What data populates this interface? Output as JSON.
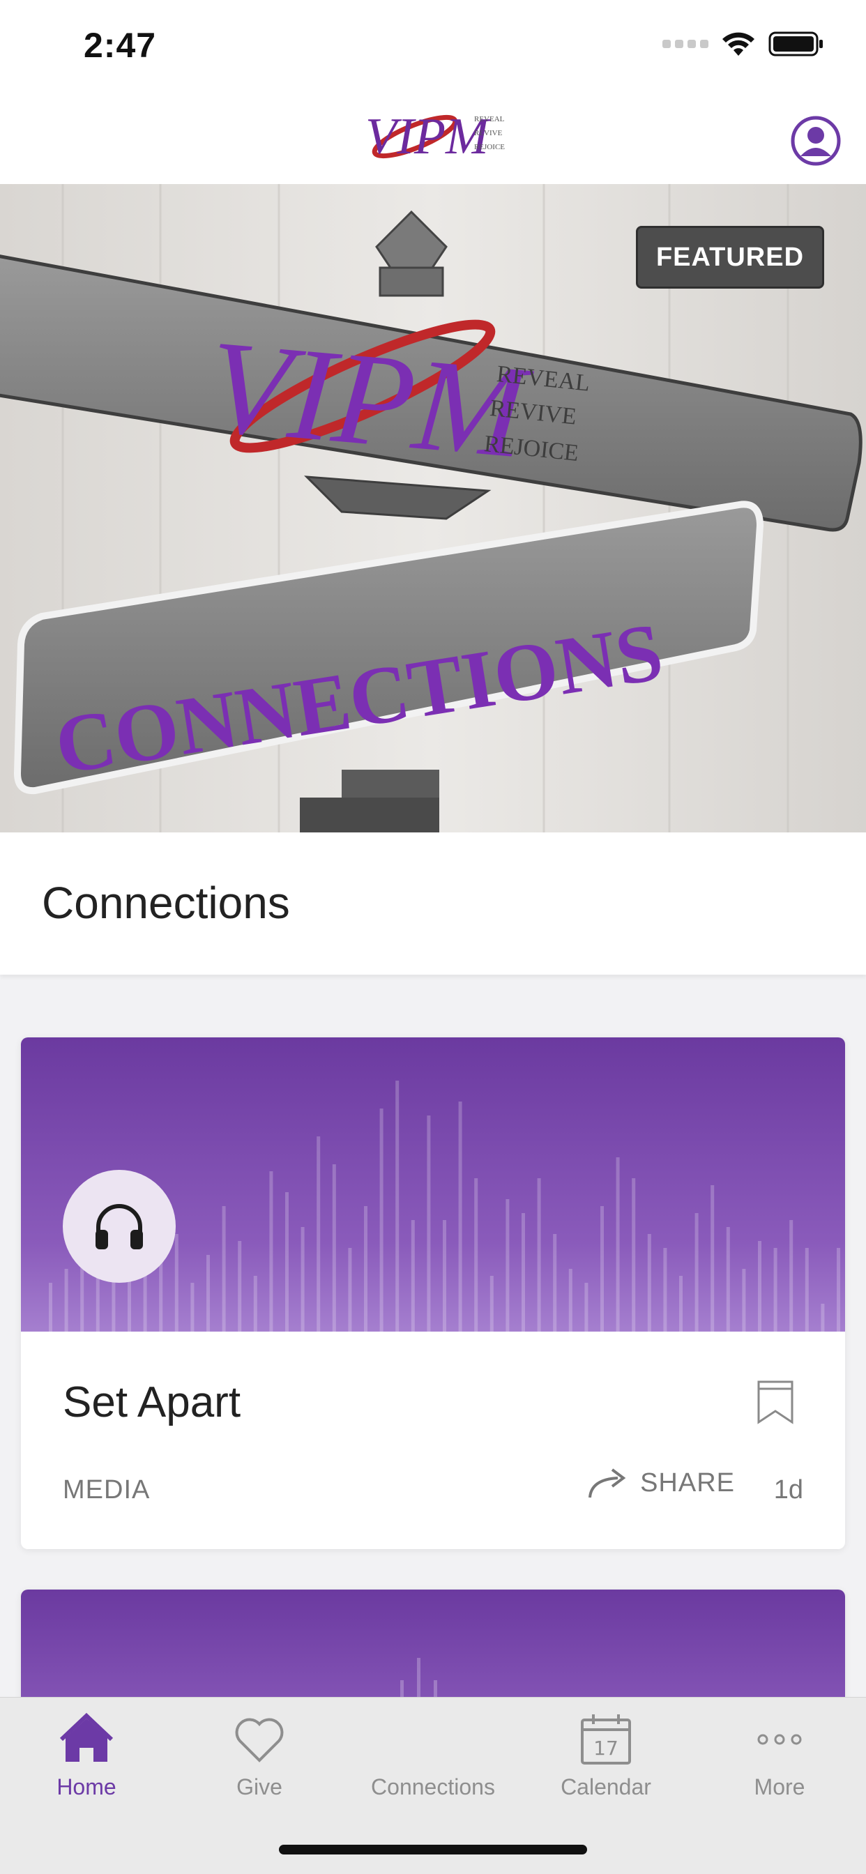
{
  "status_bar": {
    "time": "2:47",
    "icons": [
      "cellular-signal-icon",
      "wifi-icon",
      "battery-icon"
    ]
  },
  "header": {
    "logo_text": "VIPM",
    "logo_tagline": [
      "REVEAL",
      "REVIVE",
      "REJOICE"
    ],
    "profile_icon": "profile-icon"
  },
  "featured": {
    "badge": "FEATURED",
    "image_text_top": "VIPM",
    "image_tagline": [
      "REVEAL",
      "REVIVE",
      "REJOICE"
    ],
    "image_text_bottom": "CONNECTIONS",
    "title": "Connections"
  },
  "cards": [
    {
      "title": "Set Apart",
      "type": "MEDIA",
      "share_label": "SHARE",
      "age": "1d",
      "icon": "headphones-icon"
    }
  ],
  "tab_bar": {
    "items": [
      {
        "label": "Home",
        "icon": "home-icon",
        "active": true
      },
      {
        "label": "Give",
        "icon": "heart-icon",
        "active": false
      },
      {
        "label": "Connections",
        "icon": "connections-icon",
        "active": false
      },
      {
        "label": "Calendar",
        "icon": "calendar-icon",
        "active": false,
        "icon_number": "17"
      },
      {
        "label": "More",
        "icon": "more-icon",
        "active": false
      }
    ]
  },
  "colors": {
    "brand_purple": "#6c3aa6",
    "logo_red": "#c0282a",
    "tab_inactive": "#8e8e8e",
    "badge_bg": "#4d4d4d"
  }
}
